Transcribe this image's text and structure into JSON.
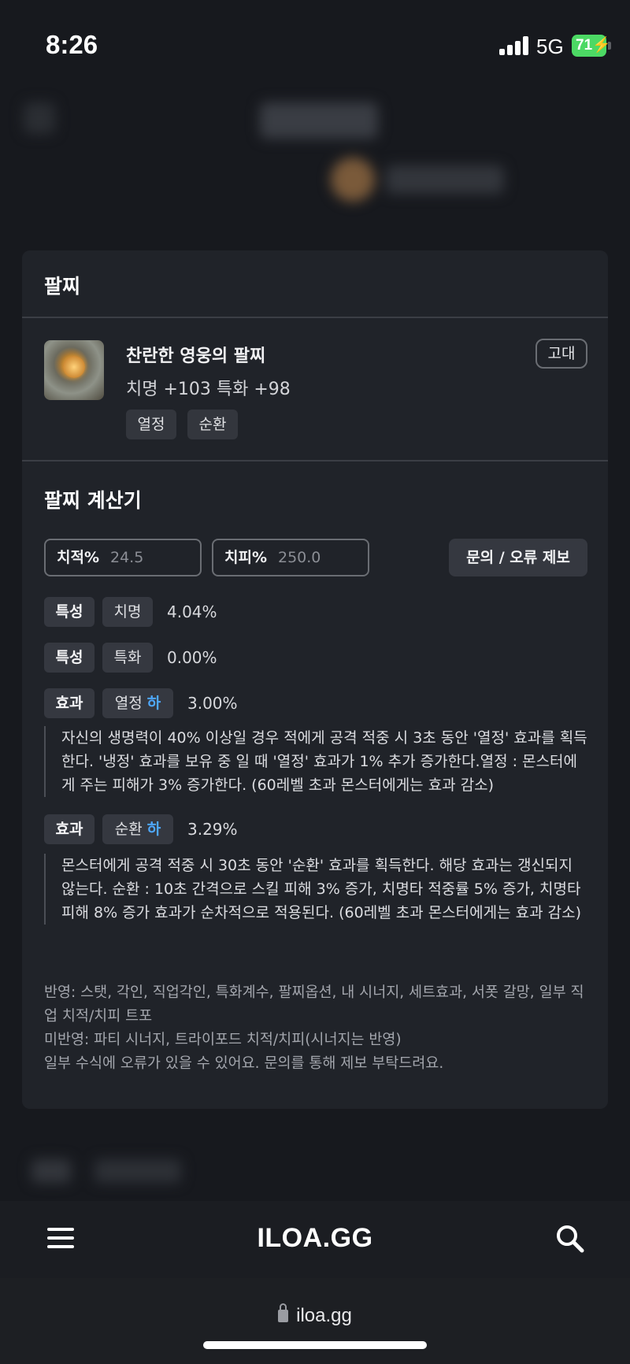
{
  "status_bar": {
    "time": "8:26",
    "network": "5G",
    "battery": "71"
  },
  "card": {
    "title": "팔찌",
    "item": {
      "name": "찬란한 영웅의 팔찌",
      "stats": "치명 +103  특화 +98",
      "grade": "고대",
      "tags": [
        "열정",
        "순환"
      ]
    },
    "calculator": {
      "title": "팔찌 계산기",
      "crit_rate": {
        "label": "치적%",
        "value": "24.5"
      },
      "crit_damage": {
        "label": "치피%",
        "value": "250.0"
      },
      "report_label": "문의 / 오류 제보",
      "rows": [
        {
          "type": "특성",
          "name": "치명",
          "tier": "",
          "percent": "4.04%"
        },
        {
          "type": "특성",
          "name": "특화",
          "tier": "",
          "percent": "0.00%"
        },
        {
          "type": "효과",
          "name": "열정",
          "tier": "하",
          "percent": "3.00%",
          "description": "자신의 생명력이 40% 이상일 경우 적에게 공격 적중 시 3초 동안 '열정' 효과를 획득한다. '냉정' 효과를 보유 중 일 때 '열정' 효과가 1% 추가 증가한다.열정 : 몬스터에게 주는 피해가 3% 증가한다. (60레벨 초과 몬스터에게는 효과 감소)"
        },
        {
          "type": "효과",
          "name": "순환",
          "tier": "하",
          "percent": "3.29%",
          "description": "몬스터에게 공격 적중 시 30초 동안 '순환' 효과를 획득한다. 해당 효과는 갱신되지 않는다. 순환 : 10초 간격으로 스킬 피해 3% 증가, 치명타 적중률 5% 증가, 치명타 피해 8% 증가 효과가 순차적으로 적용된다. (60레벨 초과 몬스터에게는 효과 감소)"
        }
      ],
      "notes": [
        "반영: 스탯, 각인, 직업각인, 특화계수, 팔찌옵션, 내 시너지, 세트효과, 서폿 갈망, 일부 직업 치적/치피 트포",
        "미반영: 파티 시너지, 트라이포드 치적/치피(시너지는 반영)",
        "일부 수식에 오류가 있을 수 있어요. 문의를 통해 제보 부탁드려요."
      ]
    }
  },
  "nav": {
    "logo": "ILOA.GG"
  },
  "browser": {
    "url": "iloa.gg"
  },
  "icons": {
    "menu": "hamburger-menu-icon",
    "search": "search-icon",
    "lock": "lock-icon"
  },
  "colors": {
    "background": "#17191e",
    "card": "#202329",
    "tier_accent": "#4ea8ff",
    "battery": "#4cd964"
  }
}
